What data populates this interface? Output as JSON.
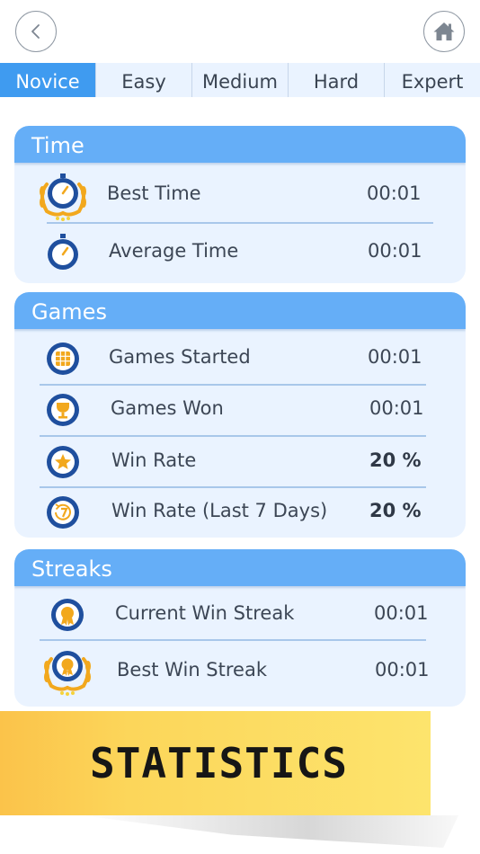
{
  "nav": {
    "back_icon": "chevron-left-icon",
    "home_icon": "home-icon"
  },
  "tabs": [
    {
      "label": "Novice",
      "active": true
    },
    {
      "label": "Easy",
      "active": false
    },
    {
      "label": "Medium",
      "active": false
    },
    {
      "label": "Hard",
      "active": false
    },
    {
      "label": "Expert",
      "active": false
    }
  ],
  "time": {
    "title": "Time",
    "rows": [
      {
        "label": "Best Time",
        "value": "00:01",
        "icon": "stopwatch-laurel-icon"
      },
      {
        "label": "Average Time",
        "value": "00:01",
        "icon": "stopwatch-icon"
      }
    ]
  },
  "games": {
    "title": "Games",
    "rows": [
      {
        "label": "Games Started",
        "value": "00:01",
        "icon": "grid-icon"
      },
      {
        "label": "Games Won",
        "value": "00:01",
        "icon": "trophy-icon"
      },
      {
        "label": "Win Rate",
        "value": "20 %",
        "icon": "star-icon"
      },
      {
        "label": "Win Rate (Last 7 Days)",
        "value": "20 %",
        "icon": "seven-days-icon"
      }
    ]
  },
  "streaks": {
    "title": "Streaks",
    "rows": [
      {
        "label": "Current Win Streak",
        "value": "00:01",
        "icon": "medal-icon"
      },
      {
        "label": "Best Win Streak",
        "value": "00:01",
        "icon": "medal-laurel-icon"
      }
    ]
  },
  "banner": {
    "title": "STATISTICS"
  },
  "colors": {
    "accent": "#3f9bf0",
    "header": "#65aef7",
    "card": "#eaf3ff",
    "icon_ring": "#1f4f9e",
    "gold": "#f2a81d",
    "banner": "#fcd65a"
  }
}
